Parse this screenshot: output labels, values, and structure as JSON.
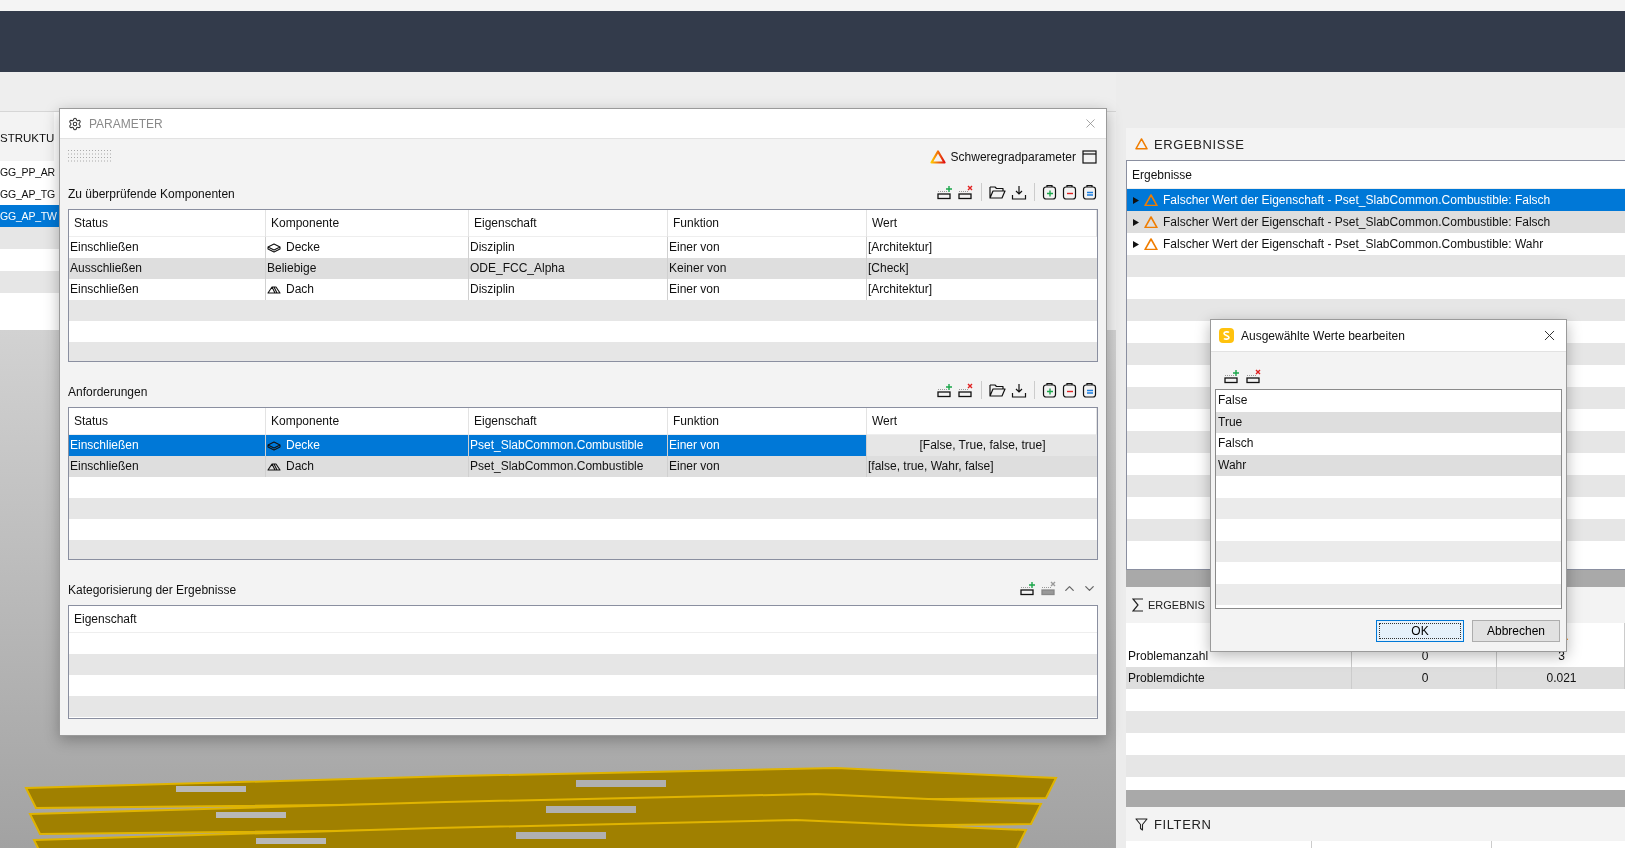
{
  "structure_panel": {
    "title": "STRUKTU",
    "items": [
      {
        "label": "GG_PP_AR",
        "selected": false
      },
      {
        "label": "GG_AP_TG",
        "selected": false
      },
      {
        "label": "GG_AP_TW",
        "selected": true
      }
    ]
  },
  "parameter_dialog": {
    "title": "PARAMETER",
    "severity_label": "Schweregradparameter",
    "components": {
      "label": "Zu überprüfende Komponenten",
      "columns": [
        "Status",
        "Komponente",
        "Eigenschaft",
        "Funktion",
        "Wert"
      ],
      "rows": [
        {
          "status": "Einschließen",
          "component": "Decke",
          "kind": "slab",
          "property": "Disziplin",
          "function": "Einer von",
          "value": "[Architektur]",
          "selected": false,
          "value_editing": false
        },
        {
          "status": "Ausschließen",
          "component": "Beliebige",
          "kind": "any",
          "property": "ODE_FCC_Alpha",
          "function": "Keiner von",
          "value": "[Check]",
          "selected": false,
          "value_editing": false
        },
        {
          "status": "Einschließen",
          "component": "Dach",
          "kind": "roof",
          "property": "Disziplin",
          "function": "Einer von",
          "value": "[Architektur]",
          "selected": false,
          "value_editing": false
        }
      ]
    },
    "requirements": {
      "label": "Anforderungen",
      "columns": [
        "Status",
        "Komponente",
        "Eigenschaft",
        "Funktion",
        "Wert"
      ],
      "rows": [
        {
          "status": "Einschließen",
          "component": "Decke",
          "kind": "slab",
          "property": "Pset_SlabCommon.Combustible",
          "function": "Einer von",
          "value": "[False, True, false, true]",
          "selected": true,
          "value_editing": true
        },
        {
          "status": "Einschließen",
          "component": "Dach",
          "kind": "roof",
          "property": "Pset_SlabCommon.Combustible",
          "function": "Einer von",
          "value": "[false, true, Wahr, false]",
          "selected": false,
          "value_editing": false
        }
      ]
    },
    "categorization": {
      "label": "Kategorisierung der Ergebnisse",
      "columns": [
        "Eigenschaft"
      ]
    }
  },
  "results_panel": {
    "title": "ERGEBNISSE",
    "column": "Ergebnisse",
    "items": [
      {
        "text": "Falscher Wert der Eigenschaft - Pset_SlabCommon.Combustible: Falsch",
        "selected": true
      },
      {
        "text": "Falscher Wert der Eigenschaft - Pset_SlabCommon.Combustible: Falsch",
        "selected": false
      },
      {
        "text": "Falscher Wert der Eigenschaft - Pset_SlabCommon.Combustible: Wahr",
        "selected": false
      }
    ]
  },
  "summary_panel": {
    "title": "ERGEBNIS",
    "rows": [
      {
        "label": "Problemanzahl",
        "cells": [
          "0",
          "3"
        ]
      },
      {
        "label": "Problemdichte",
        "cells": [
          "0",
          "0.021"
        ]
      }
    ]
  },
  "filter_panel": {
    "title": "FILTERN"
  },
  "edit_dialog": {
    "title": "Ausgewählte Werte bearbeiten",
    "values": [
      "False",
      "True",
      "Falsch",
      "Wahr"
    ],
    "buttons": [
      {
        "label": "OK",
        "kind": "default"
      },
      {
        "label": "Abbrechen",
        "kind": "normal"
      }
    ]
  }
}
